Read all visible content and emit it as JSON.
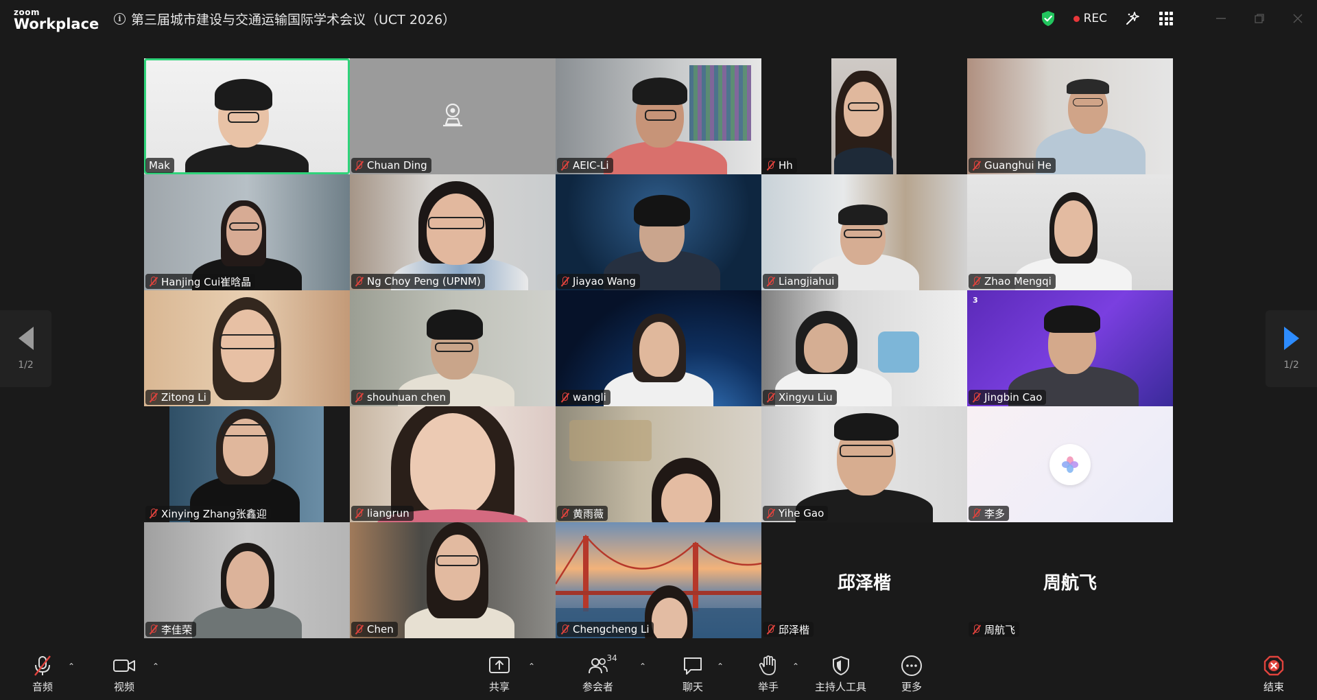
{
  "app": {
    "logo_top": "zoom",
    "logo_bottom": "Workplace"
  },
  "meeting": {
    "title": "第三届城市建设与交通运输国际学术会议（UCT 2026）"
  },
  "titlebar": {
    "rec_label": "REC"
  },
  "colors": {
    "speaker_border": "#2fd37a",
    "rec_dot": "#e8373a",
    "security_shield": "#22c55e",
    "pager_active": "#2d8cff",
    "muted_mic": "#e0433d",
    "end_icon": "#e0433d"
  },
  "pager": {
    "left_label": "1/2",
    "right_label": "1/2"
  },
  "participants": [
    {
      "name": "Mak",
      "muted": false,
      "active_speaker": true
    },
    {
      "name": "Chuan Ding",
      "muted": true,
      "video_off": true
    },
    {
      "name": "AEIC-Li",
      "muted": true
    },
    {
      "name": "Hh",
      "muted": true
    },
    {
      "name": "Guanghui He",
      "muted": true
    },
    {
      "name": "Hanjing Cui崔晗晶",
      "muted": true
    },
    {
      "name": "Ng Choy Peng (UPNM)",
      "muted": true
    },
    {
      "name": "Jiayao Wang",
      "muted": true
    },
    {
      "name": "Liangjiahui",
      "muted": true
    },
    {
      "name": "Zhao Mengqi",
      "muted": true
    },
    {
      "name": "Zitong Li",
      "muted": true
    },
    {
      "name": "shouhuan chen",
      "muted": true
    },
    {
      "name": "wangli",
      "muted": true
    },
    {
      "name": "Xingyu Liu",
      "muted": true
    },
    {
      "name": "Jingbin Cao",
      "muted": true
    },
    {
      "name": "Xinying Zhang张鑫迎",
      "muted": true
    },
    {
      "name": "liangrun",
      "muted": true
    },
    {
      "name": "黄雨薇",
      "muted": true
    },
    {
      "name": "Yihe Gao",
      "muted": true
    },
    {
      "name": "李多",
      "muted": true,
      "video_off": true
    },
    {
      "name": "李佳荣",
      "muted": true
    },
    {
      "name": "Chen",
      "muted": true
    },
    {
      "name": "Chengcheng Li",
      "muted": true
    },
    {
      "name": "邱泽楷",
      "muted": true,
      "video_off": true,
      "display_name": "邱泽楷"
    },
    {
      "name": "周航飞",
      "muted": true,
      "video_off": true,
      "display_name": "周航飞"
    }
  ],
  "toolbar": {
    "audio": "音频",
    "video": "视频",
    "share": "共享",
    "participants": "参会者",
    "participants_count": "34",
    "chat": "聊天",
    "raise_hand": "举手",
    "host_tools": "主持人工具",
    "more": "更多",
    "end": "结束"
  }
}
